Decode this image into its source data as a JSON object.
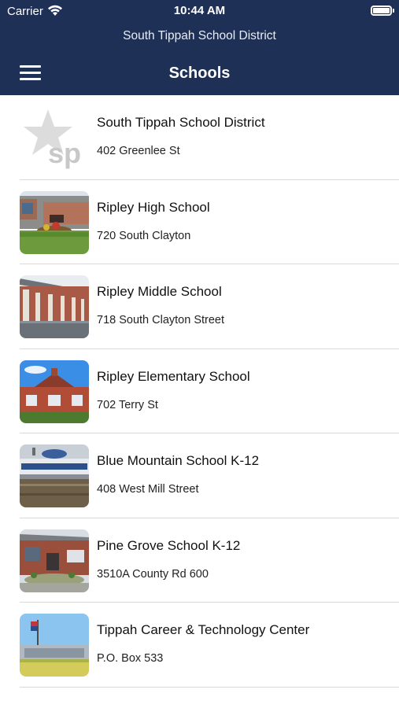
{
  "status_bar": {
    "carrier": "Carrier",
    "time": "10:44 AM",
    "wifi_icon": "wifi-icon",
    "battery_icon": "battery-icon"
  },
  "header": {
    "district": "South Tippah School District",
    "title": "Schools",
    "menu_icon": "hamburger-menu-icon",
    "background": "#1e3056"
  },
  "schools": [
    {
      "name": "South Tippah School District",
      "address": "402 Greenlee St",
      "thumb": "district-logo"
    },
    {
      "name": "Ripley High School",
      "address": "720 South Clayton",
      "thumb": "school-photo"
    },
    {
      "name": "Ripley Middle School",
      "address": "718 South Clayton Street",
      "thumb": "school-photo"
    },
    {
      "name": "Ripley Elementary School",
      "address": "702 Terry St",
      "thumb": "school-photo"
    },
    {
      "name": "Blue Mountain School K-12",
      "address": "408 West Mill Street",
      "thumb": "school-photo"
    },
    {
      "name": "Pine Grove School K-12",
      "address": "3510A County Rd 600",
      "thumb": "school-photo"
    },
    {
      "name": "Tippah Career & Technology Center",
      "address": "P.O. Box 533",
      "thumb": "school-photo"
    }
  ],
  "logo_text": "sp"
}
